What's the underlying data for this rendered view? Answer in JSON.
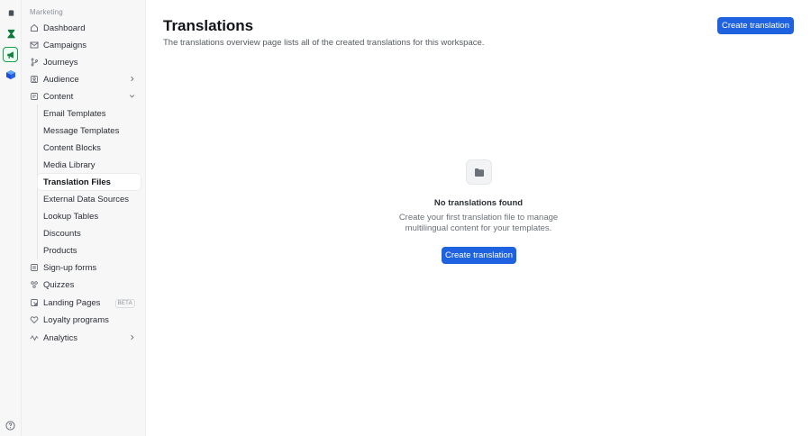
{
  "rail": {
    "items": [
      {
        "icon": "workspace-icon"
      },
      {
        "icon": "hourglass-icon"
      },
      {
        "icon": "megaphone-icon"
      },
      {
        "icon": "cube-icon"
      }
    ],
    "help_icon": "help-circle-icon"
  },
  "sidebar": {
    "section_label": "Marketing",
    "items": {
      "dashboard": "Dashboard",
      "campaigns": "Campaigns",
      "journeys": "Journeys",
      "audience": "Audience",
      "content": "Content",
      "signup_forms": "Sign-up forms",
      "quizzes": "Quizzes",
      "landing_pages": "Landing Pages",
      "landing_pages_badge": "BETA",
      "loyalty": "Loyalty programs",
      "analytics": "Analytics"
    },
    "content_children": [
      "Email Templates",
      "Message Templates",
      "Content Blocks",
      "Media Library",
      "Translation Files",
      "External Data Sources",
      "Lookup Tables",
      "Discounts",
      "Products"
    ],
    "active_child": "Translation Files"
  },
  "main": {
    "title": "Translations",
    "description": "The translations overview page lists all of the created translations for this workspace.",
    "create_button": "Create translation",
    "empty": {
      "icon": "folder-icon",
      "title": "No translations found",
      "line1": "Create your first translation file to manage",
      "line2": "multilingual content for your templates.",
      "button": "Create translation"
    }
  },
  "colors": {
    "accent": "#1e62e0",
    "rail_active": "#16a34a",
    "sidebar_bg": "#f7f7f8"
  }
}
